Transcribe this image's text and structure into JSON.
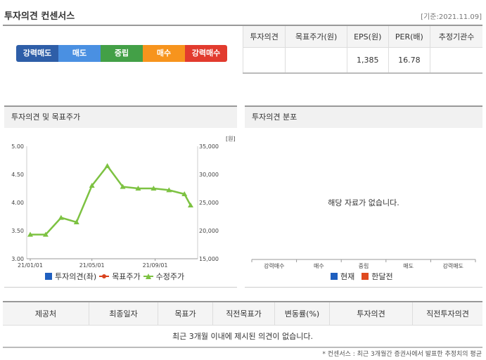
{
  "header": {
    "title": "투자의견 컨센서스",
    "date": "[기준:2021.11.09]"
  },
  "scale": {
    "items": [
      {
        "label": "강력매도",
        "color": "#2e5ea8"
      },
      {
        "label": "매도",
        "color": "#4a90e2"
      },
      {
        "label": "중립",
        "color": "#43a047"
      },
      {
        "label": "매수",
        "color": "#f7941d"
      },
      {
        "label": "강력매수",
        "color": "#e23b2e"
      }
    ]
  },
  "summary": {
    "headers": [
      "투자의견",
      "목표주가(원)",
      "EPS(원)",
      "PER(배)",
      "추정기관수"
    ],
    "values": [
      "",
      "",
      "1,385",
      "16.78",
      ""
    ]
  },
  "left_panel": {
    "title": "투자의견 및 목표주가",
    "legend": [
      "투자의견(좌)",
      "목표주가",
      "수정주가"
    ]
  },
  "right_panel": {
    "title": "투자의견 분포",
    "no_data": "해당 자료가 없습니다.",
    "categories": [
      "강력매수",
      "매수",
      "중립",
      "매도",
      "강력매도"
    ],
    "legend": [
      "현재",
      "한달전"
    ]
  },
  "opinions": {
    "headers": [
      "제공처",
      "최종일자",
      "목표가",
      "직전목표가",
      "변동률(%)",
      "투자의견",
      "직전투자의견"
    ],
    "empty": "최근 3개월 이내에 제시된 의견이 없습니다."
  },
  "footnote": "* 컨센서스 : 최근 3개월간 증권사에서 발표한 추정치의 평균",
  "colors": {
    "line": "#7dc242",
    "current": "#1f5fbf",
    "prev": "#e04a1f",
    "target": "#d9421e"
  },
  "chart_data": [
    {
      "type": "line",
      "y_left_ticks": [
        "5.00",
        "4.50",
        "4.00",
        "3.50",
        "3.00"
      ],
      "y_right_ticks": [
        "35,000",
        "30,000",
        "25,000",
        "20,000",
        "15,000"
      ],
      "y_right_unit": "[원]",
      "x_ticks": [
        "21/01/01",
        "21/05/01",
        "21/09/01"
      ],
      "ylim_left": [
        3.0,
        5.0
      ],
      "ylim_right": [
        15000,
        35000
      ],
      "series": [
        {
          "name": "수정주가",
          "x": [
            "21/01/01",
            "21/01/31",
            "21/03/02",
            "21/04/01",
            "21/05/01",
            "21/05/31",
            "21/06/30",
            "21/07/30",
            "21/08/29",
            "21/09/28",
            "21/10/28",
            "21/11/09"
          ],
          "values": [
            19300,
            19300,
            22300,
            21500,
            28000,
            31500,
            27800,
            27500,
            27500,
            27200,
            26500,
            24500
          ]
        }
      ]
    },
    {
      "type": "bar",
      "categories": [
        "강력매수",
        "매수",
        "중립",
        "매도",
        "강력매도"
      ],
      "series": [
        {
          "name": "현재",
          "values": []
        },
        {
          "name": "한달전",
          "values": []
        }
      ]
    }
  ]
}
